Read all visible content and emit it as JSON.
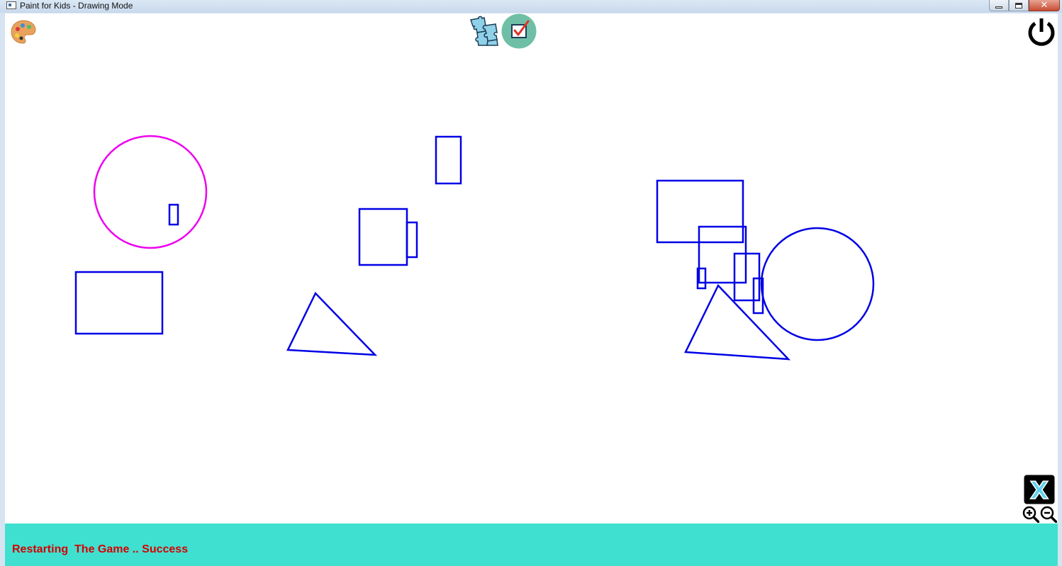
{
  "window": {
    "title": "Paint for Kids - Drawing Mode"
  },
  "toolbar": {
    "palette_icon": "palette-icon",
    "puzzle_icon": "puzzle-icon",
    "check_icon": "checkbox-check-icon",
    "power_icon": "power-icon",
    "exit_label": "X",
    "zoom_in_icon": "zoom-in-icon",
    "zoom_out_icon": "zoom-out-icon"
  },
  "status": {
    "message": "Restarting  The Game .. Success"
  },
  "colors": {
    "shape_outline": "#0000e6",
    "circle_magenta": "#ee00ee",
    "status_bar": "#40e0d0",
    "status_text": "#d40000"
  }
}
